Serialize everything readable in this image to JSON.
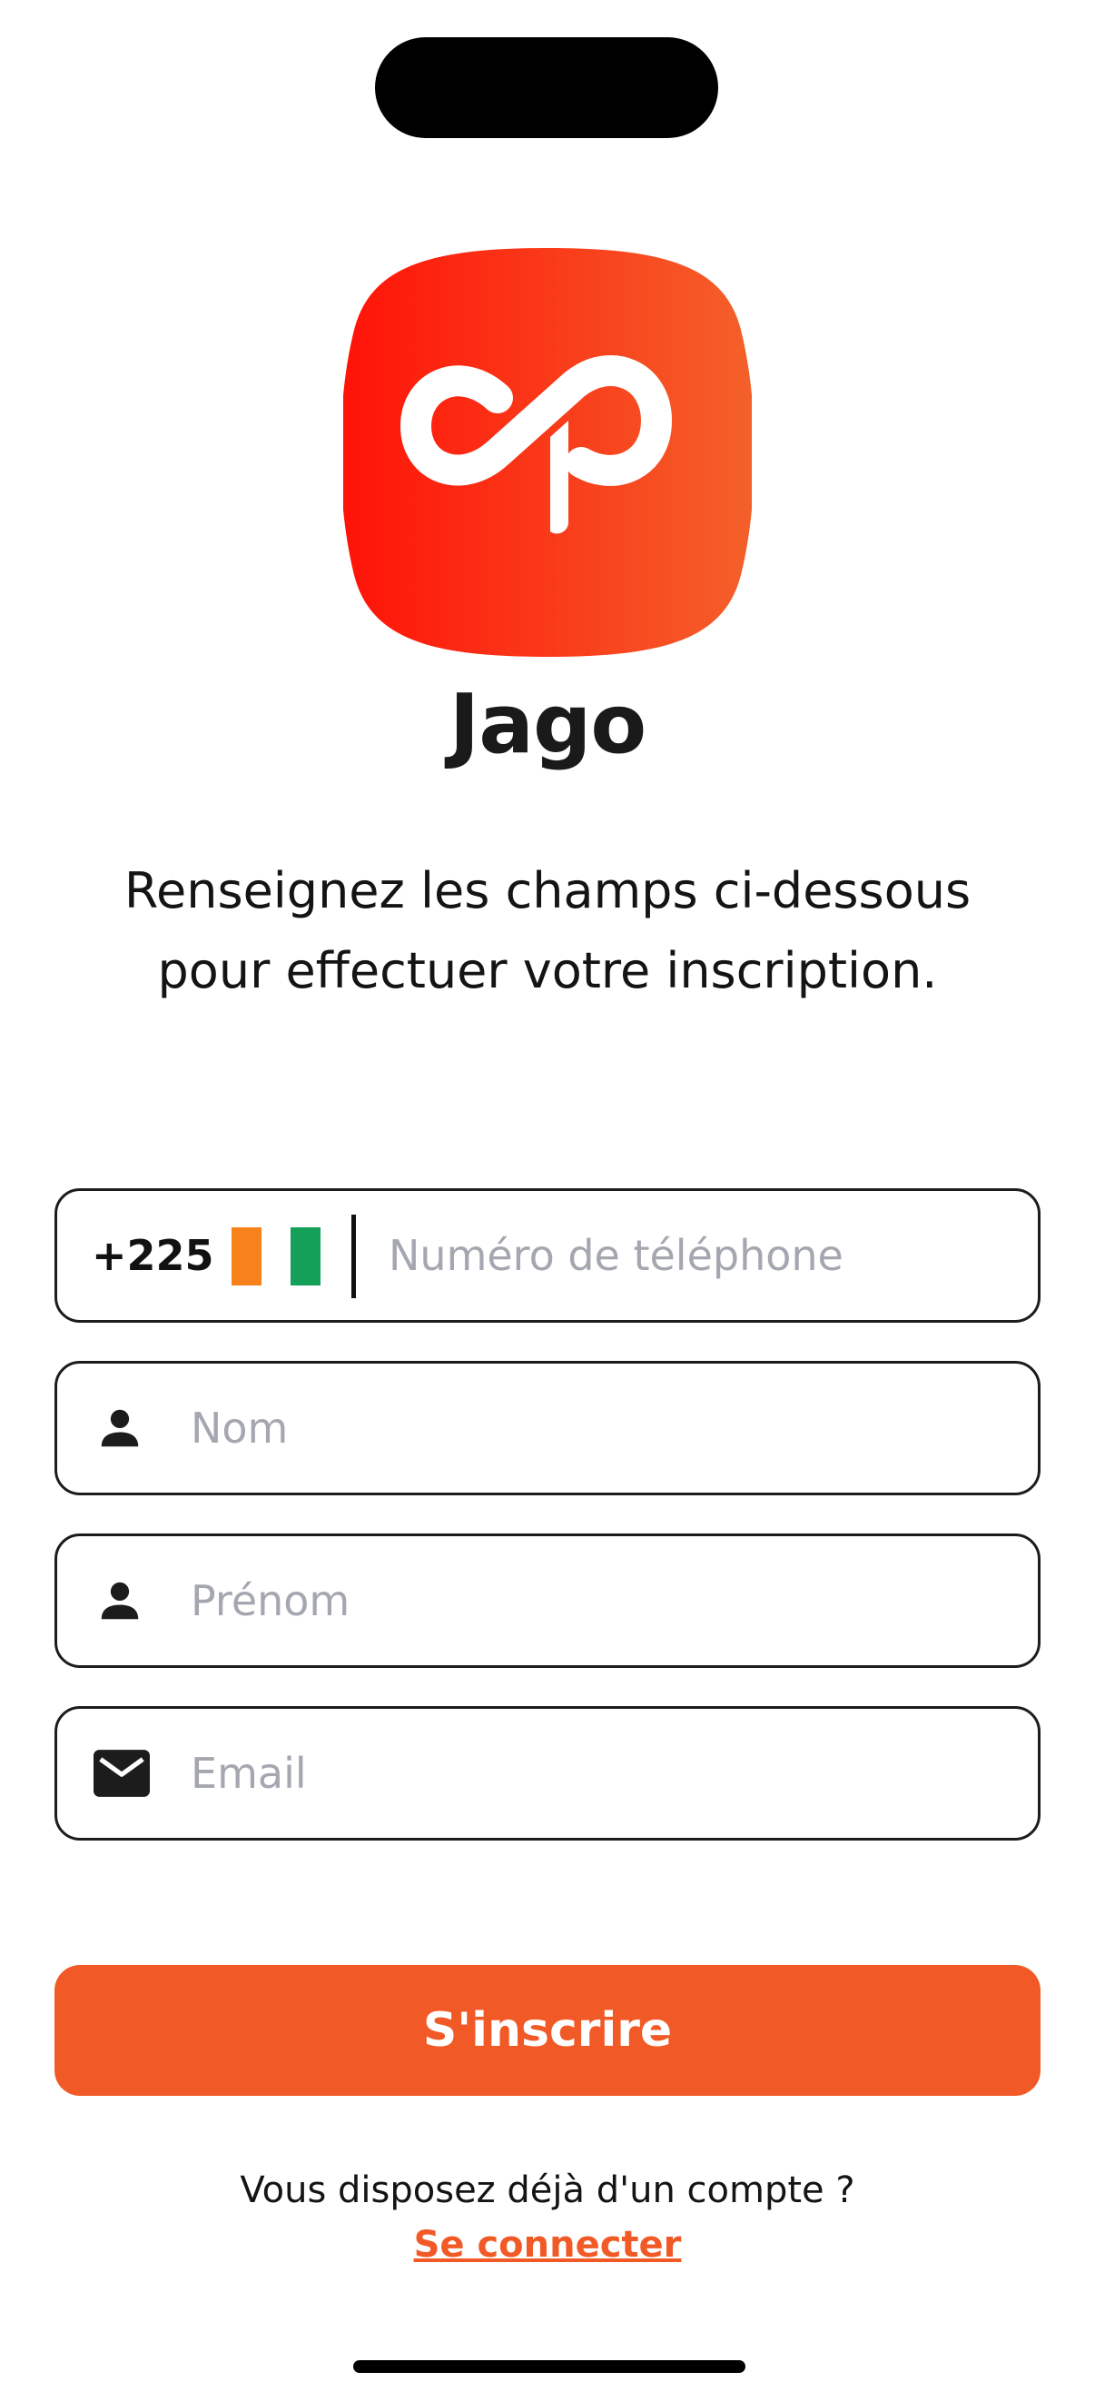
{
  "app": {
    "name": "Jago"
  },
  "intro": {
    "line1": "Renseignez les champs ci-dessous",
    "line2": "pour effectuer votre inscription."
  },
  "form": {
    "phone": {
      "dial_code": "+225",
      "country_flag": "cote-divoire-flag",
      "flag_colors": [
        "#f7821b",
        "#ffffff",
        "#15a05a"
      ],
      "placeholder": "Numéro de téléphone"
    },
    "last_name": {
      "icon": "person-icon",
      "placeholder": "Nom"
    },
    "first_name": {
      "icon": "person-icon",
      "placeholder": "Prénom"
    },
    "email": {
      "icon": "mail-icon",
      "placeholder": "Email"
    }
  },
  "actions": {
    "signup_label": "S'inscrire",
    "login_question": "Vous disposez déjà d'un compte ?",
    "login_link": "Se connecter"
  },
  "colors": {
    "accent": "#f15a26",
    "logo_gradient_start": "#ff1a0a",
    "logo_gradient_end": "#f4612a",
    "placeholder": "#a5a7b0"
  }
}
